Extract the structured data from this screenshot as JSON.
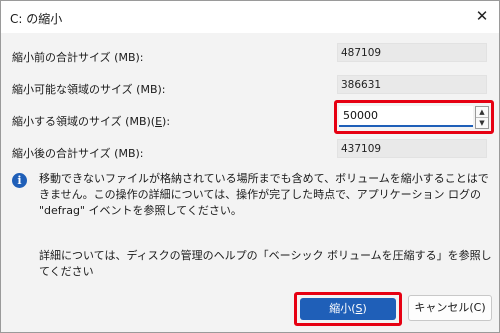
{
  "window": {
    "title": "C: の縮小",
    "close_glyph": "✕"
  },
  "fields": {
    "total_before": {
      "label": "縮小前の合計サイズ (MB):",
      "value": "487109"
    },
    "shrinkable": {
      "label": "縮小可能な領域のサイズ (MB):",
      "value": "386631"
    },
    "shrink_amount": {
      "label_prefix": "縮小する領域のサイズ (MB)(",
      "label_key": "E",
      "label_suffix": "):",
      "value": "50000"
    },
    "total_after": {
      "label": "縮小後の合計サイズ (MB):",
      "value": "437109"
    }
  },
  "info": {
    "icon": "info-icon",
    "message": "移動できないファイルが格納されている場所までも含めて、ボリュームを縮小することはできません。この操作の詳細については、操作が完了した時点で、アプリケーション ログの \"defrag\" イベントを参照してください。",
    "help": "詳細については、ディスクの管理のヘルプの「ベーシック ボリュームを圧縮する」を参照してください"
  },
  "buttons": {
    "shrink": {
      "label_prefix": "縮小(",
      "label_key": "S",
      "label_suffix": ")"
    },
    "cancel": {
      "label": "キャンセル(C)"
    }
  },
  "colors": {
    "accent": "#1f5fb8",
    "highlight": "#e60012",
    "dialog_bg": "#f3f3f3"
  }
}
